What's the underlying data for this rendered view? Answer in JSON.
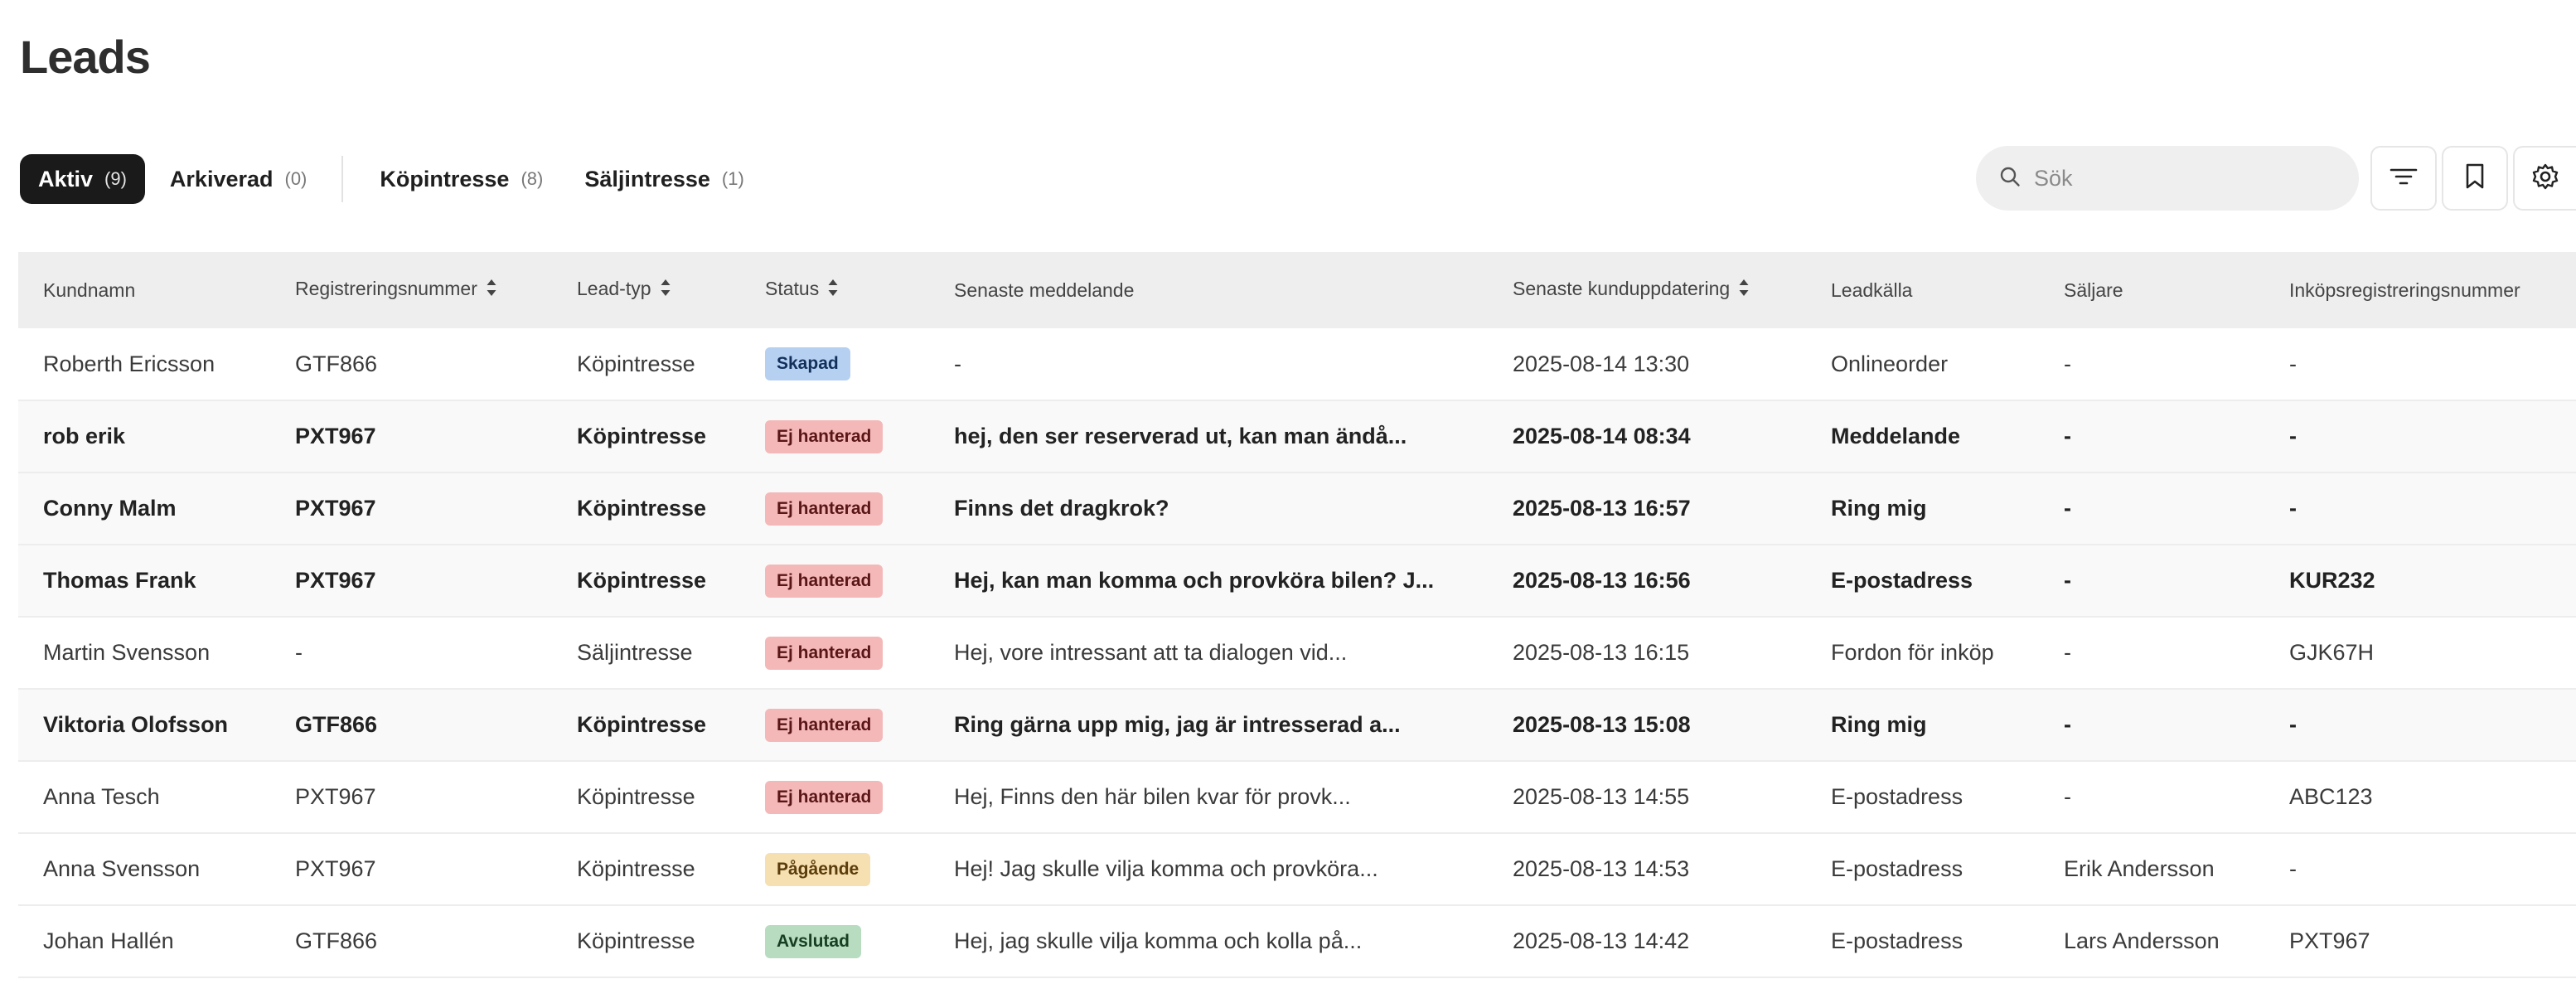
{
  "page": {
    "title": "Leads"
  },
  "tabs": [
    {
      "label": "Aktiv",
      "count": "(9)"
    },
    {
      "label": "Arkiverad",
      "count": "(0)"
    },
    {
      "label": "Köpintresse",
      "count": "(8)"
    },
    {
      "label": "Säljintresse",
      "count": "(1)"
    }
  ],
  "search": {
    "placeholder": "Sök",
    "icon": "search-icon"
  },
  "toolbar": {
    "icons": [
      "filter-icon",
      "bookmark-icon",
      "gear-icon"
    ]
  },
  "table": {
    "columns": [
      "Kundnamn",
      "Registreringsnummer",
      "Lead-typ",
      "Status",
      "Senaste meddelande",
      "Senaste kunduppdatering",
      "Leadkälla",
      "Säljare",
      "Inköpsregistreringsnummer"
    ],
    "sortable_columns": [
      "Registreringsnummer",
      "Lead-typ",
      "Status",
      "Senaste kunduppdatering"
    ],
    "rows": [
      {
        "kundnamn": "Roberth Ericsson",
        "regnr": "GTF866",
        "leadtyp": "Köpintresse",
        "status": "Skapad",
        "meddelande": "-",
        "uppdatering": "2025-08-14 13:30",
        "leadkalla": "Onlineorder",
        "saljare": "-",
        "inkopsregnr": "-"
      },
      {
        "kundnamn": "rob erik",
        "regnr": "PXT967",
        "leadtyp": "Köpintresse",
        "status": "Ej hanterad",
        "meddelande": "hej, den ser reserverad ut, kan man ändå...",
        "uppdatering": "2025-08-14 08:34",
        "leadkalla": "Meddelande",
        "saljare": "-",
        "inkopsregnr": "-"
      },
      {
        "kundnamn": "Conny Malm",
        "regnr": "PXT967",
        "leadtyp": "Köpintresse",
        "status": "Ej hanterad",
        "meddelande": "Finns det dragkrok?",
        "uppdatering": "2025-08-13 16:57",
        "leadkalla": "Ring mig",
        "saljare": "-",
        "inkopsregnr": "-"
      },
      {
        "kundnamn": "Thomas Frank",
        "regnr": "PXT967",
        "leadtyp": "Köpintresse",
        "status": "Ej hanterad",
        "meddelande": "Hej, kan man komma och provköra bilen? J...",
        "uppdatering": "2025-08-13 16:56",
        "leadkalla": "E-postadress",
        "saljare": "-",
        "inkopsregnr": "KUR232"
      },
      {
        "kundnamn": "Martin Svensson",
        "regnr": "-",
        "leadtyp": "Säljintresse",
        "status": "Ej hanterad",
        "meddelande": "Hej, vore intressant att ta dialogen vid...",
        "uppdatering": "2025-08-13 16:15",
        "leadkalla": "Fordon för inköp",
        "saljare": "-",
        "inkopsregnr": "GJK67H"
      },
      {
        "kundnamn": "Viktoria Olofsson",
        "regnr": "GTF866",
        "leadtyp": "Köpintresse",
        "status": "Ej hanterad",
        "meddelande": "Ring gärna upp mig, jag är intresserad a...",
        "uppdatering": "2025-08-13 15:08",
        "leadkalla": "Ring mig",
        "saljare": "-",
        "inkopsregnr": "-"
      },
      {
        "kundnamn": "Anna Tesch",
        "regnr": "PXT967",
        "leadtyp": "Köpintresse",
        "status": "Ej hanterad",
        "meddelande": "Hej, Finns den här bilen kvar för provk...",
        "uppdatering": "2025-08-13 14:55",
        "leadkalla": "E-postadress",
        "saljare": "-",
        "inkopsregnr": "ABC123"
      },
      {
        "kundnamn": "Anna Svensson",
        "regnr": "PXT967",
        "leadtyp": "Köpintresse",
        "status": "Pågående",
        "meddelande": "Hej! Jag skulle vilja komma och provköra...",
        "uppdatering": "2025-08-13 14:53",
        "leadkalla": "E-postadress",
        "saljare": "Erik Andersson",
        "inkopsregnr": "-"
      },
      {
        "kundnamn": "Johan Hallén",
        "regnr": "GTF866",
        "leadtyp": "Köpintresse",
        "status": "Avslutad",
        "meddelande": "Hej, jag skulle vilja komma och kolla på...",
        "uppdatering": "2025-08-13 14:42",
        "leadkalla": "E-postadress",
        "saljare": "Lars Andersson",
        "inkopsregnr": "PXT967"
      }
    ]
  }
}
